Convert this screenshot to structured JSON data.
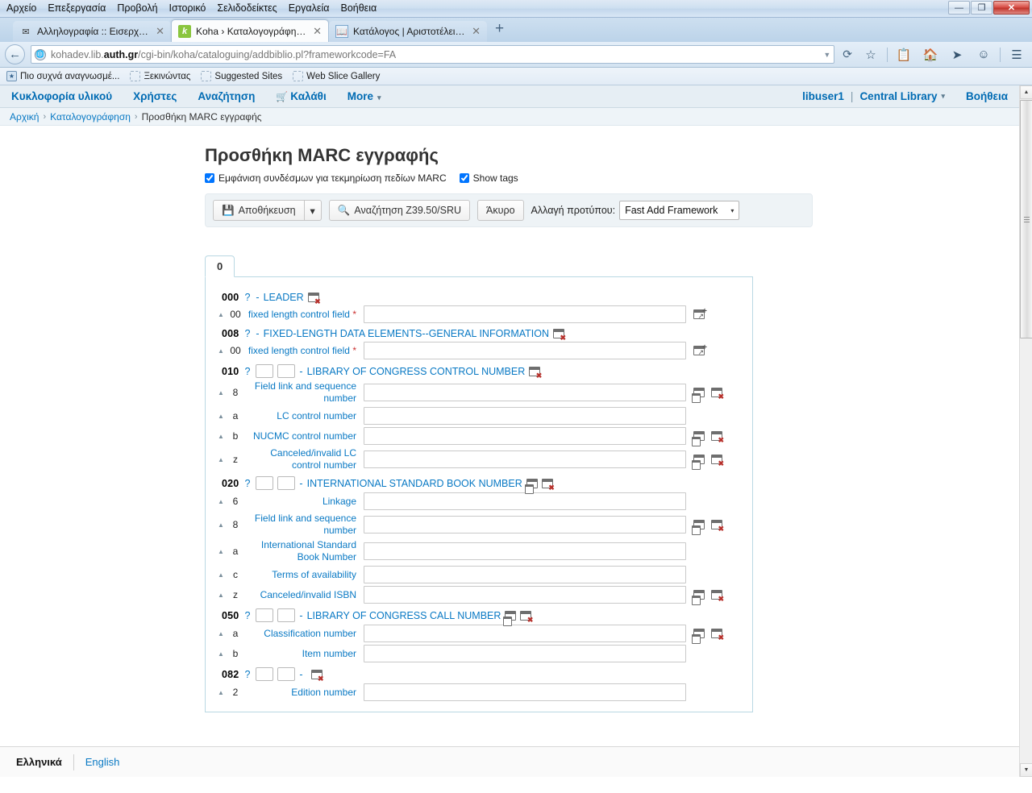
{
  "window": {
    "menus": [
      "Αρχείο",
      "Επεξεργασία",
      "Προβολή",
      "Ιστορικό",
      "Σελιδοδείκτες",
      "Εργαλεία",
      "Βοήθεια"
    ],
    "minimize_label": "—",
    "restore_label": "❐",
    "close_label": "✕"
  },
  "browser": {
    "tabs": [
      {
        "title": "Αλληλογραφία :: Εισερχόμ...",
        "icon": "mail-icon",
        "active": false
      },
      {
        "title": "Koha › Καταλογογράφηση ...",
        "icon": "koha-icon",
        "active": true
      },
      {
        "title": "Κατάλογος | Αριστοτέλειο ...",
        "icon": "catalog-icon",
        "active": false
      }
    ],
    "new_tab_label": "+",
    "close_tab_label": "✕",
    "back_label": "←",
    "url_prefix": "kohadev.lib.",
    "url_domain": "auth.gr",
    "url_path": "/cgi-bin/koha/cataloguing/addbiblio.pl?frameworkcode=FA",
    "url_dropdown": "▼",
    "reload_label": "⟳",
    "toolbar_icons": [
      "star-icon",
      "reading-list-icon",
      "home-icon",
      "send-icon",
      "feedback-icon",
      "menu-icon"
    ],
    "bookmarks": [
      {
        "label": "Πιο συχνά αναγνωσμέ...",
        "icon": "most-visited-icon"
      },
      {
        "label": "Ξεκινώντας",
        "icon": "folder-icon"
      },
      {
        "label": "Suggested Sites",
        "icon": "folder-icon"
      },
      {
        "label": "Web Slice Gallery",
        "icon": "folder-icon"
      }
    ]
  },
  "koha": {
    "nav": [
      {
        "label": "Κυκλοφορία υλικού"
      },
      {
        "label": "Χρήστες"
      },
      {
        "label": "Αναζήτηση"
      },
      {
        "label": "Καλάθι",
        "icon": "cart-icon"
      },
      {
        "label": "More",
        "caret": "▾"
      }
    ],
    "user": "libuser1",
    "user_separator": "|",
    "branch": "Central Library",
    "branch_caret": "▾",
    "help": "Βοήθεια",
    "breadcrumb": [
      {
        "label": "Αρχική",
        "link": true
      },
      {
        "label": "Καταλογογράφηση",
        "link": true
      },
      {
        "label": "Προσθήκη MARC εγγραφής",
        "link": false
      }
    ],
    "breadcrumb_arrow": "›"
  },
  "main": {
    "title": "Προσθήκη MARC εγγραφής",
    "checkboxes": [
      {
        "label": "Εμφάνιση συνδέσμων για τεκμηρίωση πεδίων MARC",
        "checked": true
      },
      {
        "label": "Show tags",
        "checked": true
      }
    ],
    "toolbar": {
      "save_label": "Αποθήκευση",
      "save_icon": "save-icon",
      "split_caret": "▾",
      "z3950_label": "Αναζήτηση Z39.50/SRU",
      "z3950_icon": "search-icon",
      "cancel_label": "Άκυρο",
      "framework_label": "Αλλαγή προτύπου:",
      "framework_value": "Fast Add Framework",
      "framework_caret": "▾"
    },
    "tabs": [
      {
        "label": "0",
        "active": true
      }
    ]
  },
  "marc_fields": [
    {
      "tag": "000",
      "help": "?",
      "indicators": false,
      "dash": "-",
      "label": "LEADER",
      "icons": [
        "delete-field-icon"
      ],
      "subfields": [
        {
          "code": "00",
          "label": "fixed length control field",
          "required": true,
          "value": "",
          "icons": [
            "tag-editor-icon"
          ]
        }
      ]
    },
    {
      "tag": "008",
      "help": "?",
      "indicators": false,
      "dash": "-",
      "label": "FIXED-LENGTH DATA ELEMENTS--GENERAL INFORMATION",
      "icons": [
        "delete-field-icon"
      ],
      "subfields": [
        {
          "code": "00",
          "label": "fixed length control field",
          "required": true,
          "value": "",
          "icons": [
            "tag-editor-icon"
          ]
        }
      ]
    },
    {
      "tag": "010",
      "help": "?",
      "indicators": true,
      "ind1": "",
      "ind2": "",
      "dash": "-",
      "label": "LIBRARY OF CONGRESS CONTROL NUMBER",
      "icons": [
        "delete-field-icon"
      ],
      "subfields": [
        {
          "code": "8",
          "label": "Field link and sequence number",
          "required": false,
          "value": "",
          "icons": [
            "clone-subfield-icon",
            "delete-subfield-icon"
          ]
        },
        {
          "code": "a",
          "label": "LC control number",
          "required": false,
          "value": "",
          "icons": []
        },
        {
          "code": "b",
          "label": "NUCMC control number",
          "required": false,
          "value": "",
          "icons": [
            "clone-subfield-icon",
            "delete-subfield-icon"
          ]
        },
        {
          "code": "z",
          "label": "Canceled/invalid LC control number",
          "required": false,
          "value": "",
          "icons": [
            "clone-subfield-icon",
            "delete-subfield-icon"
          ]
        }
      ]
    },
    {
      "tag": "020",
      "help": "?",
      "indicators": true,
      "ind1": "",
      "ind2": "",
      "dash": "-",
      "label": "INTERNATIONAL STANDARD BOOK NUMBER",
      "icons": [
        "clone-field-icon",
        "delete-field-icon"
      ],
      "subfields": [
        {
          "code": "6",
          "label": "Linkage",
          "required": false,
          "value": "",
          "icons": []
        },
        {
          "code": "8",
          "label": "Field link and sequence number",
          "required": false,
          "value": "",
          "icons": [
            "clone-subfield-icon",
            "delete-subfield-icon"
          ]
        },
        {
          "code": "a",
          "label": "International Standard Book Number",
          "required": false,
          "value": "",
          "icons": []
        },
        {
          "code": "c",
          "label": "Terms of availability",
          "required": false,
          "value": "",
          "icons": []
        },
        {
          "code": "z",
          "label": "Canceled/invalid ISBN",
          "required": false,
          "value": "",
          "icons": [
            "clone-subfield-icon",
            "delete-subfield-icon"
          ]
        }
      ]
    },
    {
      "tag": "050",
      "help": "?",
      "indicators": true,
      "ind1": "",
      "ind2": "",
      "dash": "-",
      "label": "LIBRARY OF CONGRESS CALL NUMBER",
      "icons": [
        "clone-field-icon",
        "delete-field-icon"
      ],
      "subfields": [
        {
          "code": "a",
          "label": "Classification number",
          "required": false,
          "value": "",
          "icons": [
            "clone-subfield-icon",
            "delete-subfield-icon"
          ]
        },
        {
          "code": "b",
          "label": "Item number",
          "required": false,
          "value": "",
          "icons": []
        }
      ]
    },
    {
      "tag": "082",
      "help": "?",
      "indicators": true,
      "ind1": "",
      "ind2": "",
      "dash": "-",
      "label": "",
      "icons": [
        "delete-field-icon"
      ],
      "subfields": [
        {
          "code": "2",
          "label": "Edition number",
          "required": false,
          "value": "",
          "icons": []
        }
      ]
    }
  ],
  "footer": {
    "current_language": "Ελληνικά",
    "other_language": "English"
  }
}
